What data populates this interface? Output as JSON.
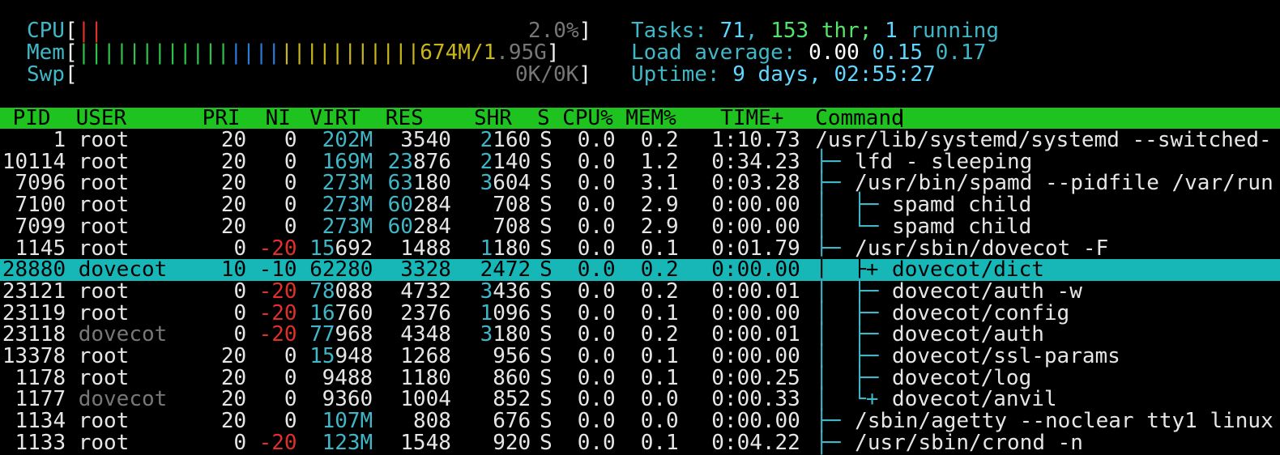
{
  "meters": {
    "cpu": {
      "label": "CPU",
      "bar": "||",
      "value": "2.0%"
    },
    "mem": {
      "label": "Mem",
      "bar_green": "||||||||||||",
      "bar_blue": "||||",
      "bar_yellow": "|||||||||||",
      "value_used": "674M",
      "value_sep": "/",
      "value_total_a": "1",
      "value_total_b": ".95G"
    },
    "swp": {
      "label": "Swp",
      "value": "0K/0K"
    }
  },
  "summary": {
    "tasks_label": "Tasks: ",
    "tasks": "71",
    "comma": ", ",
    "threads": "153",
    "thr_label": " thr; ",
    "running": "1",
    "running_label": " running",
    "load_label": "Load average: ",
    "load1": "0.00",
    "load5": "0.15",
    "load15": "0.17",
    "uptime_label": "Uptime: ",
    "uptime": "9 days, 02:55:27"
  },
  "columns": [
    "PID",
    "USER",
    "PRI",
    "NI",
    "VIRT",
    "RES",
    "SHR",
    "S",
    "CPU%",
    "MEM%",
    "TIME+",
    "Command"
  ],
  "rows": [
    {
      "pid": "1",
      "user": "root",
      "pri": "20",
      "ni": "0",
      "virt_a": "202",
      "virt_b": "M",
      "res_a": "",
      "res_b": "3540",
      "shr_a": "2",
      "shr_b": "160",
      "s": "S",
      "cpu": "0.0",
      "mem": "0.2",
      "time": "1:10.73",
      "tree": "",
      "cmd": "/usr/lib/systemd/systemd --switched-"
    },
    {
      "pid": "10114",
      "user": "root",
      "pri": "20",
      "ni": "0",
      "virt_a": "169",
      "virt_b": "M",
      "res_a": "23",
      "res_b": "876",
      "shr_a": "2",
      "shr_b": "140",
      "s": "S",
      "cpu": "0.0",
      "mem": "1.2",
      "time": "0:34.23",
      "tree": "├─ ",
      "cmd": "lfd - sleeping"
    },
    {
      "pid": "7096",
      "user": "root",
      "pri": "20",
      "ni": "0",
      "virt_a": "273",
      "virt_b": "M",
      "res_a": "63",
      "res_b": "180",
      "shr_a": "3",
      "shr_b": "604",
      "s": "S",
      "cpu": "0.0",
      "mem": "3.1",
      "time": "0:03.28",
      "tree": "├─ ",
      "cmd": "/usr/bin/spamd --pidfile /var/run"
    },
    {
      "pid": "7100",
      "user": "root",
      "pri": "20",
      "ni": "0",
      "virt_a": "273",
      "virt_b": "M",
      "res_a": "60",
      "res_b": "284",
      "shr_a": "",
      "shr_b": "708",
      "s": "S",
      "cpu": "0.0",
      "mem": "2.9",
      "time": "0:00.00",
      "tree": "│  ├─ ",
      "cmd": "spamd child"
    },
    {
      "pid": "7099",
      "user": "root",
      "pri": "20",
      "ni": "0",
      "virt_a": "273",
      "virt_b": "M",
      "res_a": "60",
      "res_b": "284",
      "shr_a": "",
      "shr_b": "708",
      "s": "S",
      "cpu": "0.0",
      "mem": "2.9",
      "time": "0:00.00",
      "tree": "│  └─ ",
      "cmd": "spamd child"
    },
    {
      "pid": "1145",
      "user": "root",
      "pri": "0",
      "ni": "-20",
      "virt_a": "15",
      "virt_b": "692",
      "res_a": "",
      "res_b": "1488",
      "shr_a": "1",
      "shr_b": "180",
      "s": "S",
      "cpu": "0.0",
      "mem": "0.1",
      "time": "0:01.79",
      "tree": "├─ ",
      "cmd": "/usr/sbin/dovecot -F"
    },
    {
      "pid": "28880",
      "user": "dovecot",
      "pri": "10",
      "ni": "-10",
      "virt_a": "62",
      "virt_b": "280",
      "res_a": "",
      "res_b": "3328",
      "shr_a": "",
      "shr_b": "2472",
      "s": "S",
      "cpu": "0.0",
      "mem": "0.2",
      "time": "0:00.00",
      "tree": "│  ├+ ",
      "cmd": "dovecot/dict",
      "selected": true
    },
    {
      "pid": "23121",
      "user": "root",
      "pri": "0",
      "ni": "-20",
      "virt_a": "78",
      "virt_b": "088",
      "res_a": "",
      "res_b": "4732",
      "shr_a": "3",
      "shr_b": "436",
      "s": "S",
      "cpu": "0.0",
      "mem": "0.2",
      "time": "0:00.01",
      "tree": "│  ├─ ",
      "cmd": "dovecot/auth -w"
    },
    {
      "pid": "23119",
      "user": "root",
      "pri": "0",
      "ni": "-20",
      "virt_a": "16",
      "virt_b": "760",
      "res_a": "",
      "res_b": "2376",
      "shr_a": "1",
      "shr_b": "096",
      "s": "S",
      "cpu": "0.0",
      "mem": "0.1",
      "time": "0:00.00",
      "tree": "│  ├─ ",
      "cmd": "dovecot/config"
    },
    {
      "pid": "23118",
      "user": "dovecot",
      "pri": "0",
      "ni": "-20",
      "virt_a": "77",
      "virt_b": "968",
      "res_a": "",
      "res_b": "4348",
      "shr_a": "3",
      "shr_b": "180",
      "s": "S",
      "cpu": "0.0",
      "mem": "0.2",
      "time": "0:00.01",
      "tree": "│  ├─ ",
      "cmd": "dovecot/auth",
      "gray_user": true
    },
    {
      "pid": "13378",
      "user": "root",
      "pri": "20",
      "ni": "0",
      "virt_a": "15",
      "virt_b": "948",
      "res_a": "",
      "res_b": "1268",
      "shr_a": "",
      "shr_b": "956",
      "s": "S",
      "cpu": "0.0",
      "mem": "0.1",
      "time": "0:00.00",
      "tree": "│  ├─ ",
      "cmd": "dovecot/ssl-params"
    },
    {
      "pid": "1178",
      "user": "root",
      "pri": "20",
      "ni": "0",
      "virt_a": "",
      "virt_b": "9488",
      "res_a": "",
      "res_b": "1180",
      "shr_a": "",
      "shr_b": "860",
      "s": "S",
      "cpu": "0.0",
      "mem": "0.1",
      "time": "0:00.25",
      "tree": "│  ├─ ",
      "cmd": "dovecot/log"
    },
    {
      "pid": "1177",
      "user": "dovecot",
      "pri": "20",
      "ni": "0",
      "virt_a": "",
      "virt_b": "9360",
      "res_a": "",
      "res_b": "1004",
      "shr_a": "",
      "shr_b": "852",
      "s": "S",
      "cpu": "0.0",
      "mem": "0.0",
      "time": "0:00.33",
      "tree": "│  └+ ",
      "cmd": "dovecot/anvil",
      "gray_user": true
    },
    {
      "pid": "1134",
      "user": "root",
      "pri": "20",
      "ni": "0",
      "virt_a": "107",
      "virt_b": "M",
      "res_a": "",
      "res_b": "808",
      "shr_a": "",
      "shr_b": "676",
      "s": "S",
      "cpu": "0.0",
      "mem": "0.0",
      "time": "0:00.00",
      "tree": "├─ ",
      "cmd": "/sbin/agetty --noclear tty1 linux"
    },
    {
      "pid": "1133",
      "user": "root",
      "pri": "0",
      "ni": "-20",
      "virt_a": "123",
      "virt_b": "M",
      "res_a": "",
      "res_b": "1548",
      "shr_a": "",
      "shr_b": "920",
      "s": "S",
      "cpu": "0.0",
      "mem": "0.1",
      "time": "0:04.22",
      "tree": "├─ ",
      "cmd": "/usr/sbin/crond -n"
    }
  ]
}
